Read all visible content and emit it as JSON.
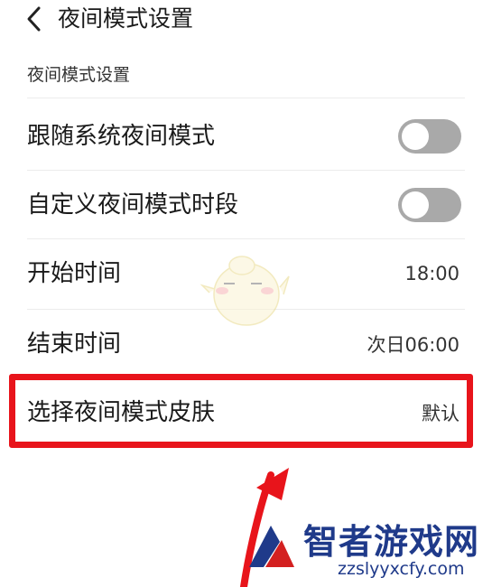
{
  "header": {
    "title": "夜间模式设置"
  },
  "section": {
    "label": "夜间模式设置"
  },
  "settings": {
    "follow_system": {
      "label": "跟随系统夜间模式",
      "enabled": false
    },
    "custom_period": {
      "label": "自定义夜间模式时段",
      "enabled": false
    },
    "start_time": {
      "label": "开始时间",
      "value": "18:00"
    },
    "end_time": {
      "label": "结束时间",
      "value": "次日06:00"
    },
    "skin": {
      "label": "选择夜间模式皮肤",
      "value": "默认"
    }
  },
  "watermark": {
    "name": "智者游戏网",
    "url": "zzslyyxcfy.com"
  },
  "colors": {
    "highlight": "#e8141b",
    "toggle_off": "#a9a9a9",
    "watermark": "#1f3a8a"
  }
}
